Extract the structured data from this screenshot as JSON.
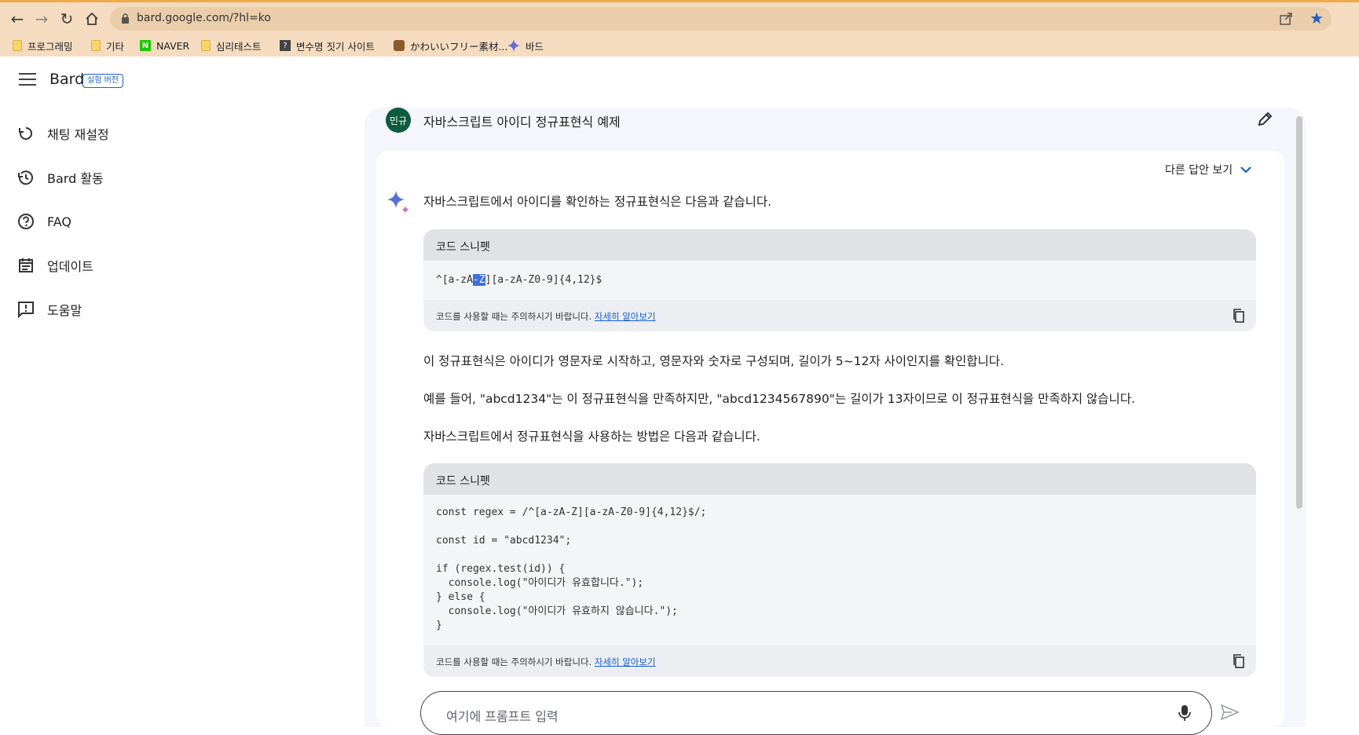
{
  "browser": {
    "url": "bard.google.com/?hl=ko",
    "bookmarks": [
      {
        "label": "프로그래밍",
        "icon": "folder-icon"
      },
      {
        "label": "기타",
        "icon": "folder-icon"
      },
      {
        "label": "NAVER",
        "icon": "naver-icon"
      },
      {
        "label": "심리테스트",
        "icon": "folder-icon"
      },
      {
        "label": "변수명 짓기 사이트",
        "icon": "question-icon"
      },
      {
        "label": "かわいいフリー素材...",
        "icon": "site-icon"
      },
      {
        "label": "바드",
        "icon": "bard-sparkle-icon"
      }
    ]
  },
  "header": {
    "brand": "Bard",
    "badge": "실험 버전"
  },
  "sidebar": {
    "items": [
      {
        "label": "채팅 재설정",
        "icon": "reset-icon"
      },
      {
        "label": "Bard 활동",
        "icon": "history-icon"
      },
      {
        "label": "FAQ",
        "icon": "help-circle-icon"
      },
      {
        "label": "업데이트",
        "icon": "calendar-icon"
      },
      {
        "label": "도움말",
        "icon": "feedback-icon"
      }
    ]
  },
  "chat": {
    "avatar": "민규",
    "prompt": "자바스크립트  아이디 정규표현식 예제",
    "other_answers": "다른 답안 보기",
    "intro": "자바스크립트에서 아이디를 확인하는 정규표현식은 다음과 같습니다.",
    "snippet1": {
      "title": "코드 스니펫",
      "code_pre": "^[a-zA",
      "code_sel": "-Z",
      "code_post": "][a-zA-Z0-9]{4,12}$",
      "footer": "코드를 사용할 때는 주의하시기 바랍니다.",
      "link": "자세히 알아보기"
    },
    "para1": "이 정규표현식은 아이디가 영문자로 시작하고, 영문자와 숫자로 구성되며, 길이가 5~12자 사이인지를 확인합니다.",
    "para2": "예를 들어, \"abcd1234\"는 이 정규표현식을 만족하지만, \"abcd1234567890\"는 길이가 13자이므로 이 정규표현식을 만족하지 않습니다.",
    "para3": "자바스크립트에서 정규표현식을 사용하는 방법은 다음과 같습니다.",
    "snippet2": {
      "title": "코드 스니펫",
      "code": "const regex = /^[a-zA-Z][a-zA-Z0-9]{4,12}$/;\n\nconst id = \"abcd1234\";\n\nif (regex.test(id)) {\n  console.log(\"아이디가 유효합니다.\");\n} else {\n  console.log(\"아이디가 유효하지 않습니다.\");\n}",
      "footer": "코드를 사용할 때는 주의하시기 바랍니다.",
      "link": "자세히 알아보기"
    }
  },
  "input": {
    "placeholder": "여기에 프롬프트 입력"
  }
}
